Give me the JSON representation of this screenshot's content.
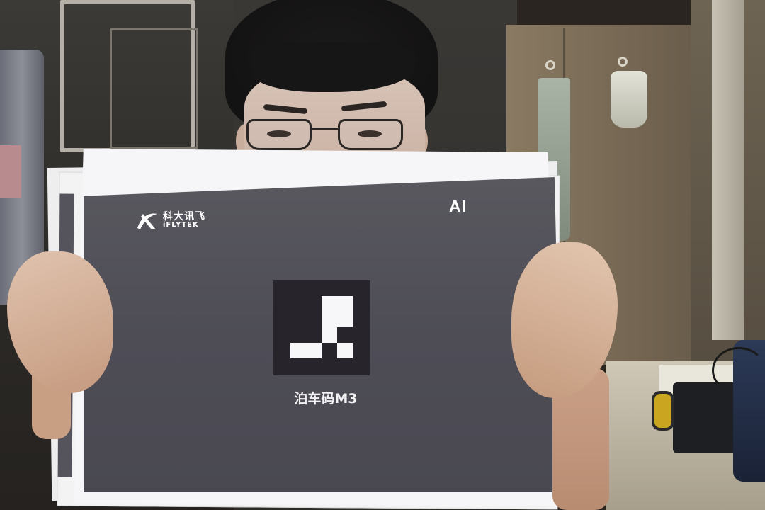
{
  "poster": {
    "brand_cn": "科大讯飞",
    "brand_en": "iFLYTEK",
    "corner_mark": "AI",
    "marker_caption": "泊车码M3"
  },
  "colors": {
    "poster_background": "#4e4d56",
    "marker_background": "#27242c",
    "marker_cells": "#f7f7f9",
    "paper": "#f6f6f8"
  },
  "icons": [
    "iflytek-logo-icon",
    "ai-logo-icon",
    "parking-marker"
  ]
}
